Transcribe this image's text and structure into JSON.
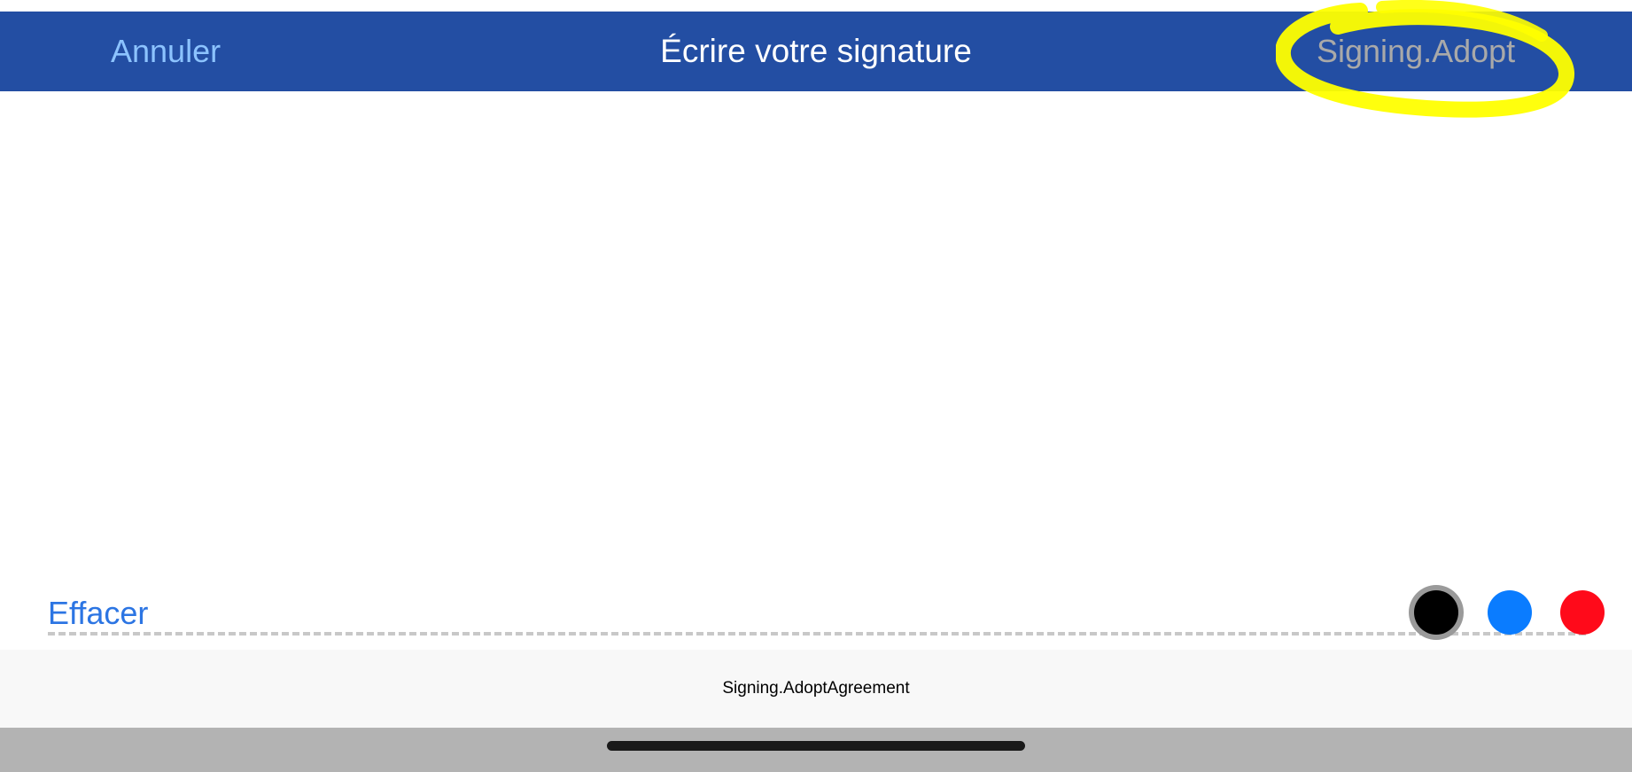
{
  "nav": {
    "cancel_label": "Annuler",
    "title": "Écrire votre signature",
    "adopt_label": "Signing.Adopt"
  },
  "signature_pad": {
    "clear_label": "Effacer",
    "ink_colors": [
      {
        "name": "black",
        "hex": "#000000",
        "selected": true
      },
      {
        "name": "blue",
        "hex": "#0a7cff",
        "selected": false
      },
      {
        "name": "red",
        "hex": "#ff0a1a",
        "selected": false
      }
    ]
  },
  "footer": {
    "agreement_text": "Signing.AdoptAgreement"
  },
  "colors": {
    "nav_background": "#234ea3",
    "cancel_text": "#8cc3ff",
    "adopt_text_disabled": "#a9a9a9",
    "clear_text": "#2c75e3",
    "annotation_highlight": "#ffff00"
  }
}
